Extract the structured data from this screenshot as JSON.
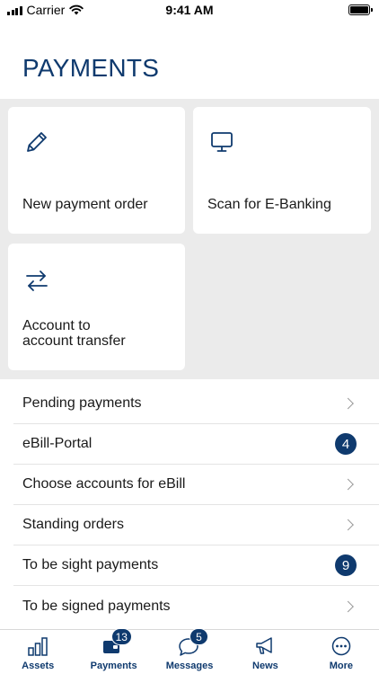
{
  "status_bar": {
    "carrier": "Carrier",
    "time": "9:41 AM"
  },
  "page": {
    "title": "PAYMENTS"
  },
  "tiles": [
    {
      "label": "New payment order",
      "icon": "pencil-icon"
    },
    {
      "label": "Scan for E-Banking",
      "icon": "monitor-icon"
    },
    {
      "label_line1": "Account to",
      "label_line2": "account transfer",
      "icon": "transfer-arrows-icon"
    }
  ],
  "list": [
    {
      "label": "Pending payments",
      "badge": null
    },
    {
      "label": "eBill-Portal",
      "badge": "4"
    },
    {
      "label": "Choose accounts for eBill",
      "badge": null
    },
    {
      "label": "Standing orders",
      "badge": null
    },
    {
      "label": "To be sight payments",
      "badge": "9"
    },
    {
      "label": "To be signed payments",
      "badge": null
    }
  ],
  "tab_bar": [
    {
      "label": "Assets",
      "icon": "bar-chart-icon",
      "badge": null
    },
    {
      "label": "Payments",
      "icon": "wallet-icon",
      "badge": "13"
    },
    {
      "label": "Messages",
      "icon": "chat-bubble-icon",
      "badge": "5"
    },
    {
      "label": "News",
      "icon": "megaphone-icon",
      "badge": null
    },
    {
      "label": "More",
      "icon": "more-dots-icon",
      "badge": null
    }
  ],
  "colors": {
    "brand": "#0f3a6e",
    "tile_background": "#ebebeb",
    "chevron": "#9a9a9a"
  }
}
